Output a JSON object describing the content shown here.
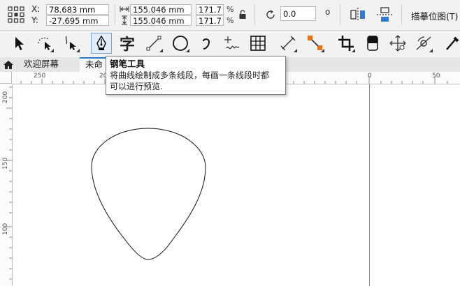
{
  "property_bar": {
    "x_label": "X:",
    "y_label": "Y:",
    "x_value": "78.683 mm",
    "y_value": "-27.695 mm",
    "width_value": "155.046 mm",
    "height_value": "155.046 mm",
    "scale_w": "171.7",
    "scale_h": "171.7",
    "percent": "%",
    "rotation_value": "0.0",
    "degree_symbol": "o",
    "trace_bitmap_label": "描摹位图(T)"
  },
  "toolbox": {
    "tools": [
      {
        "name": "pick-tool",
        "icon": "arrow-icon"
      },
      {
        "name": "shape-tool",
        "icon": "shape-icon"
      },
      {
        "name": "crop-tool",
        "icon": "crop-cursor-icon"
      },
      {
        "name": "pen-tool",
        "icon": "pen-nib-icon",
        "active": true
      },
      {
        "name": "text-tool",
        "icon": "text-icon",
        "glyph": "字"
      },
      {
        "name": "line-tool",
        "icon": "line-icon"
      },
      {
        "name": "ellipse-tool",
        "icon": "ellipse-icon"
      },
      {
        "name": "spiral-tool",
        "icon": "spiral-icon"
      },
      {
        "name": "freehand-tool",
        "icon": "freehand-icon"
      },
      {
        "name": "table-tool",
        "icon": "table-icon"
      },
      {
        "name": "dimension-tool",
        "icon": "dimension-icon"
      },
      {
        "name": "connector-tool",
        "icon": "connector-icon"
      },
      {
        "name": "blend-tool",
        "icon": "blend-icon"
      },
      {
        "name": "transparency-tool",
        "icon": "transparency-icon"
      },
      {
        "name": "move-tool",
        "icon": "move-icon"
      },
      {
        "name": "contour-tool",
        "icon": "contour-icon"
      },
      {
        "name": "color-eyedropper-tool",
        "icon": "eyedropper-icon"
      }
    ]
  },
  "tabs": {
    "home_icon": "home-icon",
    "welcome": "欢迎屏幕",
    "document": "未命"
  },
  "ruler": {
    "top": [
      "250",
      "200",
      "0",
      "50"
    ],
    "left": [
      "200",
      "150",
      "100"
    ]
  },
  "tooltip": {
    "title": "钢笔工具",
    "desc_line1": "将曲线绘制成多条线段，每画一条线段时都",
    "desc_line2": "可以进行预览."
  },
  "colors": {
    "accent": "#2b7bd6",
    "active_tool_bg": "#e2eefa",
    "connector_orange": "#e8731a"
  }
}
